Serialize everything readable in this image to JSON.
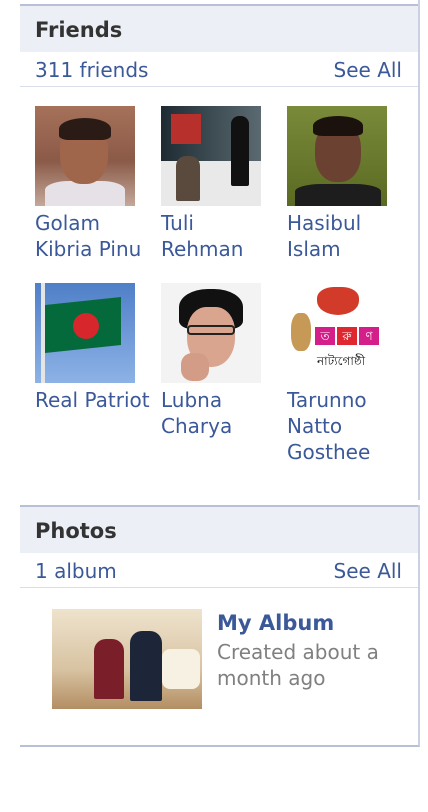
{
  "friends": {
    "title": "Friends",
    "count": "311 friends",
    "see_all": "See All",
    "items": [
      {
        "name": "Golam Kibria Pinu"
      },
      {
        "name": "Tuli Rehman"
      },
      {
        "name": "Hasibul Islam"
      },
      {
        "name": "Real Patriot"
      },
      {
        "name": "Lubna Charya"
      },
      {
        "name": "Tarunno Natto Gosthee"
      }
    ],
    "avatar6_badge": [
      "ত",
      "রু",
      "ণ"
    ],
    "avatar6_text": "নাট্যগোষ্ঠী"
  },
  "photos": {
    "title": "Photos",
    "count": "1 album",
    "see_all": "See All",
    "album": {
      "title": "My Album",
      "meta": "Created about a month ago"
    }
  },
  "colors": {
    "link": "#3b5998",
    "header_bg": "#eceff5",
    "border": "#b7c0d6",
    "muted": "#808080"
  }
}
